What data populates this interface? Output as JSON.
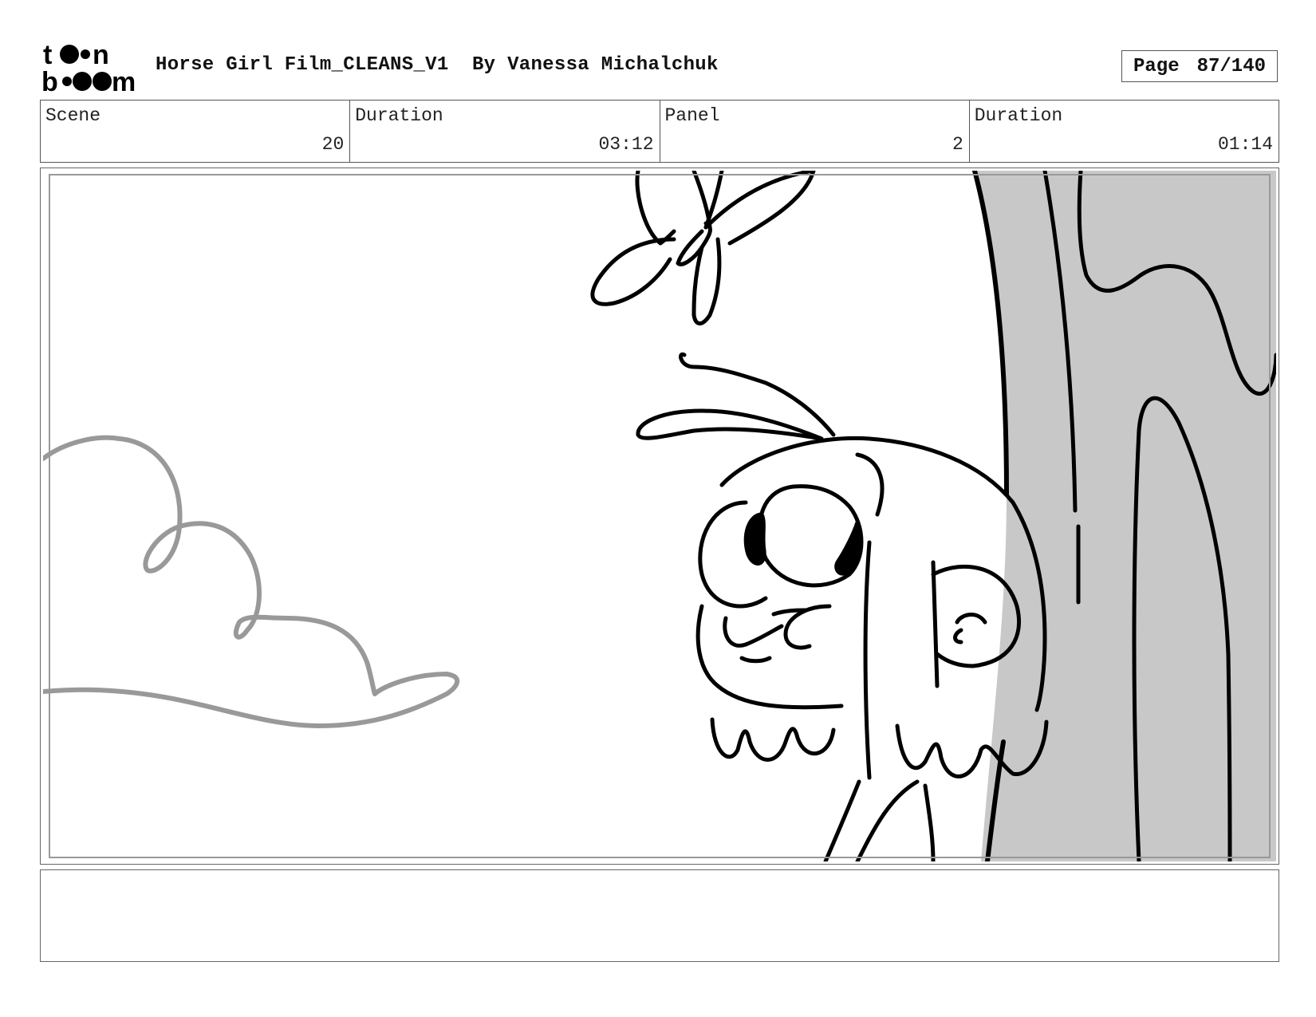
{
  "header": {
    "logo_text": "toon boom",
    "title": "Horse Girl Film_CLEANS_V1  By Vanessa Michalchuk",
    "page_label": "Page",
    "page_value": "87/140"
  },
  "info": {
    "scene_label": "Scene",
    "scene_value": "20",
    "duration_label": "Duration",
    "duration_value": "03:12",
    "panel_label": "Panel",
    "panel_value": "2",
    "panel_duration_label": "Duration",
    "panel_duration_value": "01:14"
  },
  "notes": {
    "text": ""
  },
  "colors": {
    "tree_fill": "#c8c8c8",
    "cloud_stroke": "#999999",
    "ink": "#000000"
  }
}
